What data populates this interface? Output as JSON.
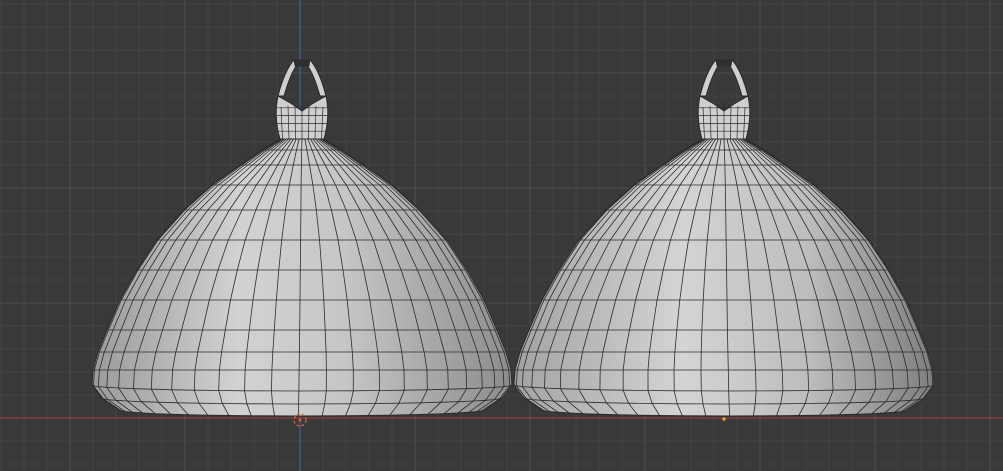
{
  "viewport": {
    "background_color": "#393939",
    "grid_minor_color": "#444444",
    "grid_major_color": "#4e4e4e",
    "x_axis_color": "#b33a3a",
    "z_axis_color": "#3a6ab3"
  },
  "objects": [
    {
      "name": "dress-left",
      "fill_color": "#cfcfcf",
      "wire_color": "#2b2b2b"
    },
    {
      "name": "dress-right",
      "fill_color": "#cfcfcf",
      "wire_color": "#2b2b2b"
    }
  ],
  "world_origin": {
    "color": "#e06040"
  },
  "icons": [
    "world-origin-icon",
    "object-origin-icon"
  ]
}
